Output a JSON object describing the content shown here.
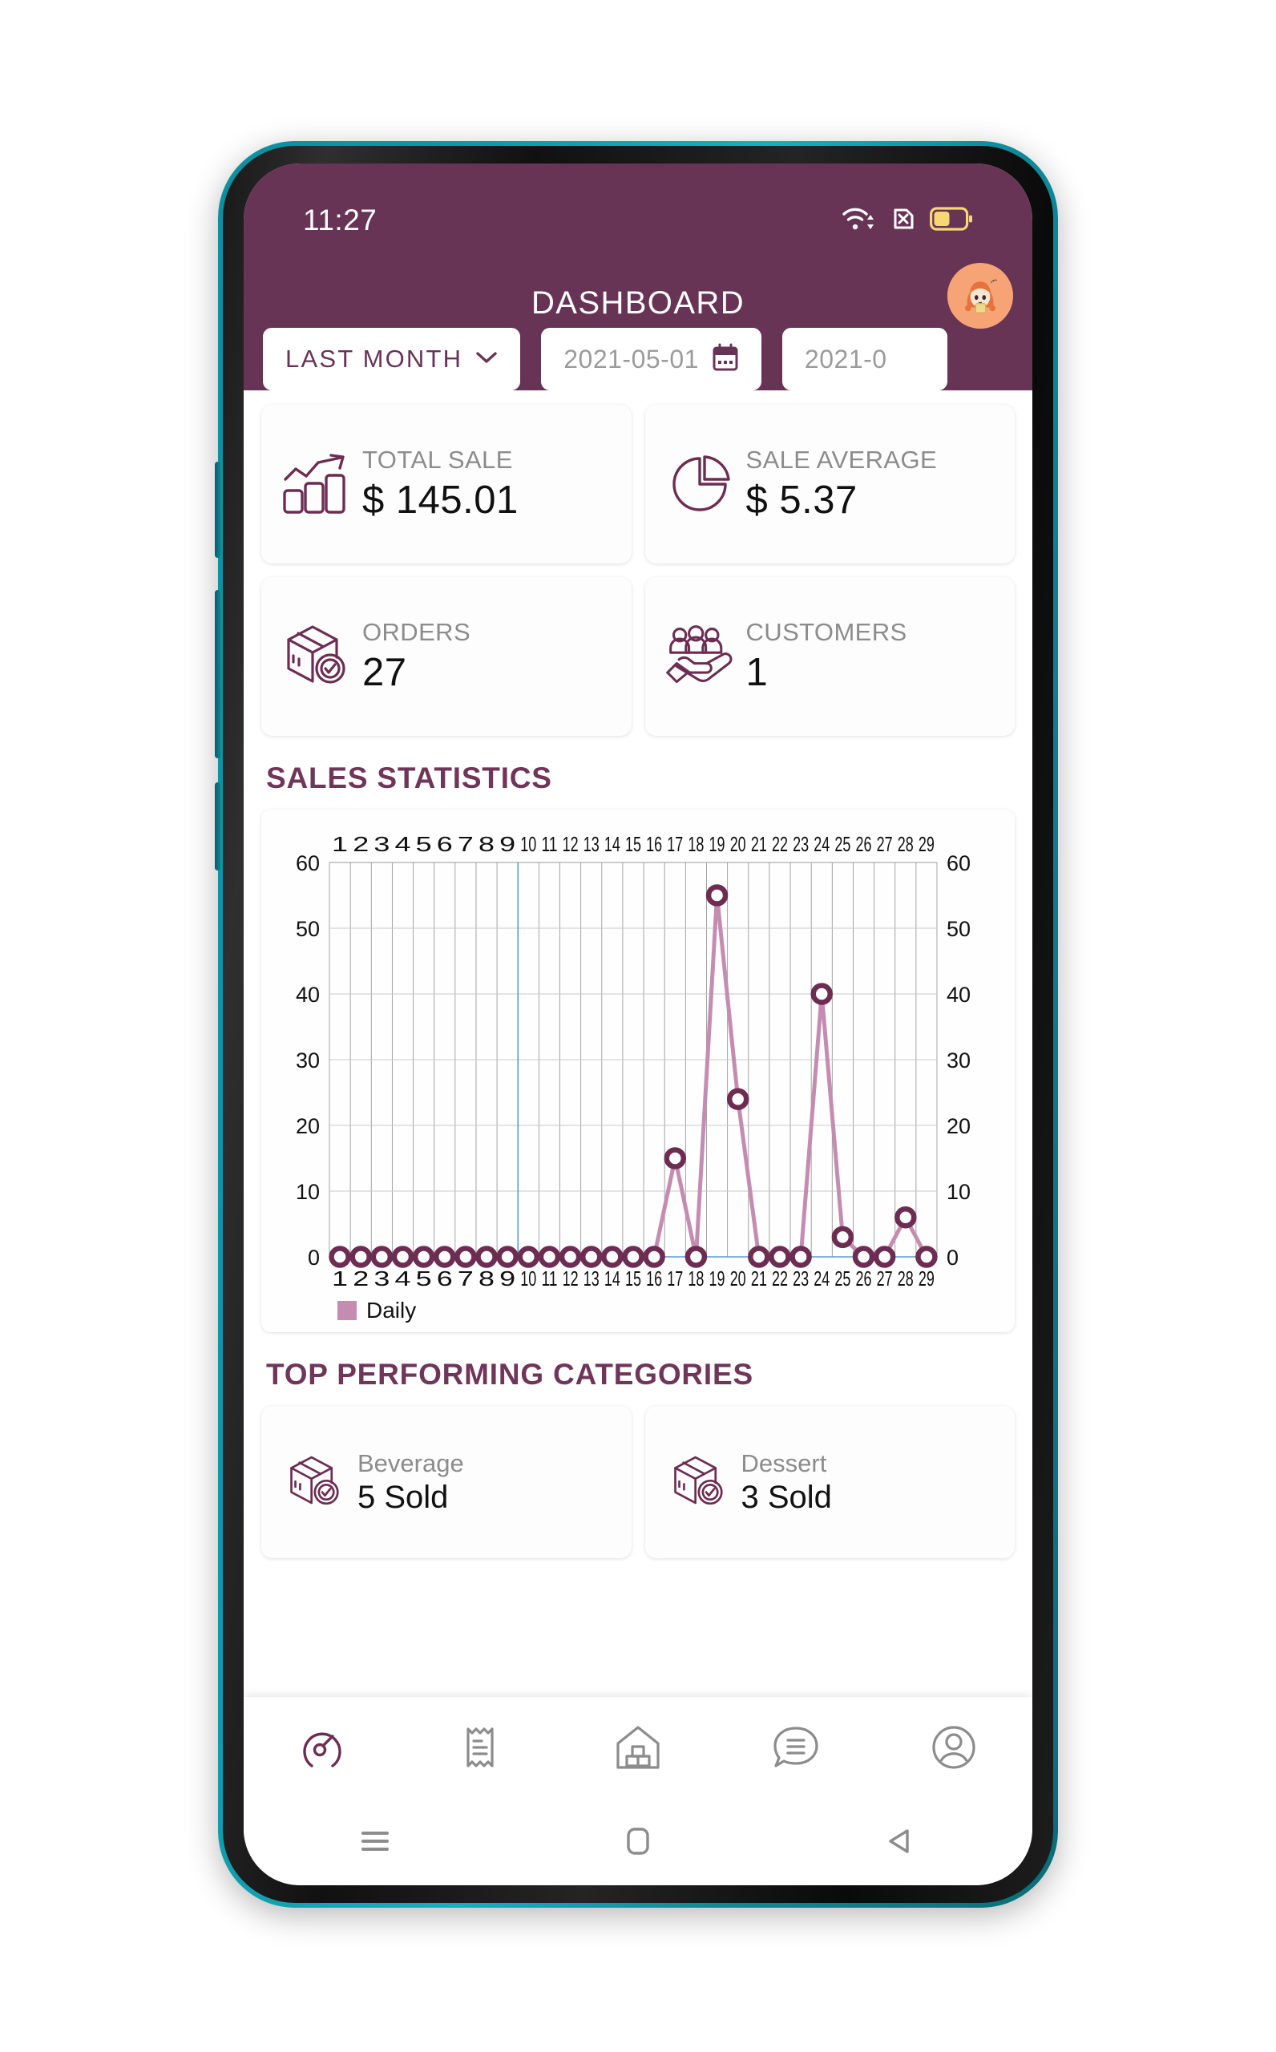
{
  "status_bar": {
    "time": "11:27",
    "icons": [
      "wifi-data-icon",
      "no-sim-icon",
      "battery-icon"
    ],
    "battery_level_pct": 50
  },
  "app_bar": {
    "title": "DASHBOARD",
    "avatar_name": "user-avatar",
    "background_color": "#683455"
  },
  "filters": {
    "range_label": "LAST MONTH",
    "range_caret": "chevron-down-icon",
    "date_from": "2021-05-01",
    "date_to": "2021-0",
    "calendar_icon": "calendar-icon"
  },
  "stats": [
    {
      "label": "TOTAL SALE",
      "value": "$ 145.01",
      "icon": "bar-chart-growth-icon"
    },
    {
      "label": "SALE AVERAGE",
      "value": "$ 5.37",
      "icon": "pie-chart-icon"
    },
    {
      "label": "ORDERS",
      "value": "27",
      "icon": "package-check-icon"
    },
    {
      "label": "CUSTOMERS",
      "value": "1",
      "icon": "customers-hand-icon"
    }
  ],
  "sections": {
    "sales_statistics": "SALES STATISTICS",
    "top_categories": "TOP PERFORMING CATEGORIES"
  },
  "categories": [
    {
      "label": "Beverage",
      "value": "5 Sold",
      "icon": "package-check-icon"
    },
    {
      "label": "Dessert",
      "value": "3 Sold",
      "icon": "package-check-icon"
    }
  ],
  "bottom_nav": [
    {
      "name": "dashboard",
      "icon": "gauge-icon",
      "active": true
    },
    {
      "name": "orders",
      "icon": "receipt-icon",
      "active": false
    },
    {
      "name": "inventory",
      "icon": "warehouse-icon",
      "active": false
    },
    {
      "name": "messages",
      "icon": "chat-icon",
      "active": false
    },
    {
      "name": "profile",
      "icon": "person-icon",
      "active": false
    }
  ],
  "android_nav": [
    {
      "name": "recents",
      "icon": "menu-icon"
    },
    {
      "name": "home",
      "icon": "home-square-icon"
    },
    {
      "name": "back",
      "icon": "back-triangle-icon"
    }
  ],
  "theme": {
    "primary": "#683455",
    "accent_line": "#c58cb2",
    "marker": "#6d2d52",
    "text_muted": "#8c8c8c"
  },
  "chart_data": {
    "type": "line",
    "title": "SALES STATISTICS",
    "xlabel": "",
    "ylabel": "",
    "grid": true,
    "legend": [
      "Daily"
    ],
    "legend_position": "bottom-left",
    "legend_color": "#c58cb2",
    "ylim": [
      0,
      60
    ],
    "yticks": [
      0,
      10,
      20,
      30,
      40,
      50,
      60
    ],
    "dual_y_axis": true,
    "categories": [
      "1",
      "2",
      "3",
      "4",
      "5",
      "6",
      "7",
      "8",
      "9",
      "10",
      "11",
      "12",
      "13",
      "14",
      "15",
      "16",
      "17",
      "18",
      "19",
      "20",
      "21",
      "22",
      "23",
      "24",
      "25",
      "26",
      "27",
      "28",
      "29"
    ],
    "series": [
      {
        "name": "Daily",
        "values": [
          0,
          0,
          0,
          0,
          0,
          0,
          0,
          0,
          0,
          0,
          0,
          0,
          0,
          0,
          0,
          0,
          15,
          0,
          55,
          24,
          0,
          0,
          0,
          40,
          3,
          0,
          0,
          6,
          0
        ]
      }
    ]
  }
}
